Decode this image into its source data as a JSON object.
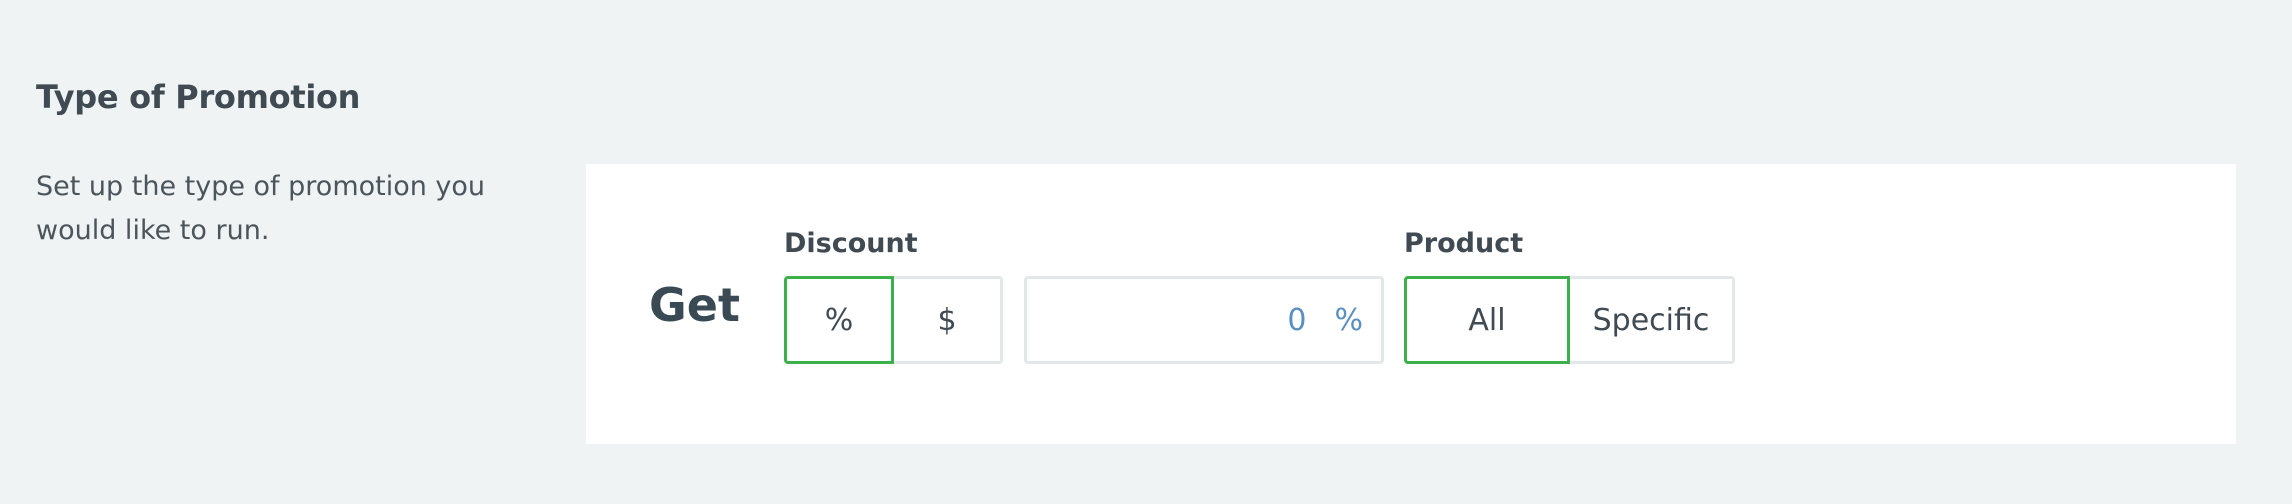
{
  "section": {
    "title": "Type of Promotion",
    "description": "Set up the type of promotion you would like to run."
  },
  "promotion": {
    "get_label": "Get",
    "discount": {
      "label": "Discount",
      "options": [
        "%",
        "$"
      ],
      "selected": "%"
    },
    "amount": {
      "value": "0",
      "unit": "%"
    },
    "product": {
      "label": "Product",
      "options": [
        "All",
        "Specific"
      ],
      "selected": "All"
    }
  },
  "colors": {
    "page_background": "#f0f3f4",
    "card_background": "#ffffff",
    "active_border": "#3cb04b",
    "inactive_border": "#e2e7ea",
    "amount_text": "#5a8fc0"
  }
}
